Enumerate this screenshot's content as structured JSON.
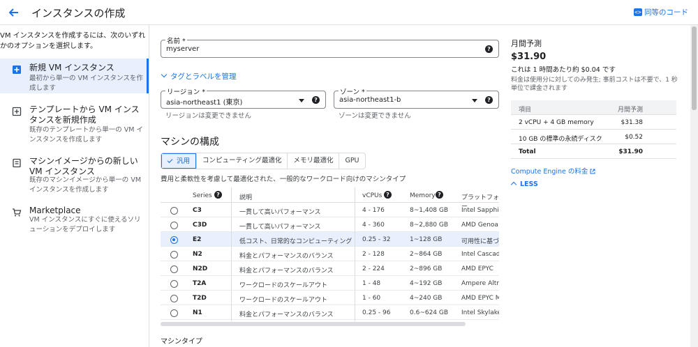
{
  "header": {
    "title": "インスタンスの作成",
    "code_link": "同等のコード"
  },
  "left": {
    "intro": "VM インスタンスを作成するには、次のいずれかのオプションを選択します。",
    "options": [
      {
        "title": "新規 VM インスタンス",
        "desc": "最初から単一の VM インスタンスを作成します"
      },
      {
        "title": "テンプレートから VM インスタンスを新規作成",
        "desc": "既存のテンプレートから単一の VM インスタンスを作成します"
      },
      {
        "title": "マシンイメージからの新しい VM インスタンス",
        "desc": "既存のマシンイメージから単一の VM インスタンスを作成します"
      },
      {
        "title": "Marketplace",
        "desc": "VM インスタンスにすぐに使えるソリューションをデプロイします"
      }
    ]
  },
  "form": {
    "name_label": "名前 *",
    "name_value": "myserver",
    "tags_link": "タグとラベルを管理",
    "region_label": "リージョン *",
    "region_value": "asia-northeast1 (東京)",
    "region_hint": "リージョンは変更できません",
    "zone_label": "ゾーン *",
    "zone_value": "asia-northeast1-b",
    "zone_hint": "ゾーンは変更できません"
  },
  "machine": {
    "section_title": "マシンの構成",
    "tabs": [
      "汎用",
      "コンピューティング最適化",
      "メモリ最適化",
      "GPU"
    ],
    "description": "費用と柔軟性を考慮して最適化された、一般的なワークロード向けのマシンタイプ",
    "columns": [
      "Series",
      "説明",
      "vCPUs",
      "Memory",
      "プラットフォー"
    ],
    "rows": [
      {
        "series": "C3",
        "desc": "一貫して高いパフォーマンス",
        "vcpus": "4 - 176",
        "memory": "8~1,408 GB",
        "platform": "Intel Sapphire"
      },
      {
        "series": "C3D",
        "desc": "一貫して高いパフォーマンス",
        "vcpus": "4 - 360",
        "memory": "8~2,880 GB",
        "platform": "AMD Genoa"
      },
      {
        "series": "E2",
        "desc": "低コスト、日常的なコンピューティング",
        "vcpus": "0.25 - 32",
        "memory": "1~128 GB",
        "platform": "可用性に基づく"
      },
      {
        "series": "N2",
        "desc": "料金とパフォーマンスのバランス",
        "vcpus": "2 - 128",
        "memory": "2~864 GB",
        "platform": "Intel Cascade"
      },
      {
        "series": "N2D",
        "desc": "料金とパフォーマンスのバランス",
        "vcpus": "2 - 224",
        "memory": "2~896 GB",
        "platform": "AMD EPYC"
      },
      {
        "series": "T2A",
        "desc": "ワークロードのスケールアウト",
        "vcpus": "1 - 48",
        "memory": "4~192 GB",
        "platform": "Ampere Altra A"
      },
      {
        "series": "T2D",
        "desc": "ワークロードのスケールアウト",
        "vcpus": "1 - 60",
        "memory": "4~240 GB",
        "platform": "AMD EPYC Mil"
      },
      {
        "series": "N1",
        "desc": "料金とパフォーマンスのバランス",
        "vcpus": "0.25 - 96",
        "memory": "0.6~624 GB",
        "platform": "Intel Skylake"
      }
    ],
    "selected_row": 2,
    "machine_type_label": "マシンタイプ"
  },
  "estimate": {
    "title": "月間予測",
    "price": "$31.90",
    "hourly": "これは 1 時間あたり約 $0.04 です",
    "note": "料金は使用分に対してのみ発生; 事前コストは不要で、1 秒単位で課金されます",
    "table_head": [
      "項目",
      "月間予測"
    ],
    "items": [
      {
        "item": "2 vCPU + 4 GB memory",
        "cost": "$31.38"
      },
      {
        "item": "10 GB の標準の永続ディスク",
        "cost": "$0.52"
      }
    ],
    "total_label": "Total",
    "total_value": "$31.90",
    "pricing_link": "Compute Engine の料金",
    "less_link": "LESS"
  },
  "colors": {
    "accent": "#1a73e8",
    "selected_bg": "#e8f0fe"
  }
}
